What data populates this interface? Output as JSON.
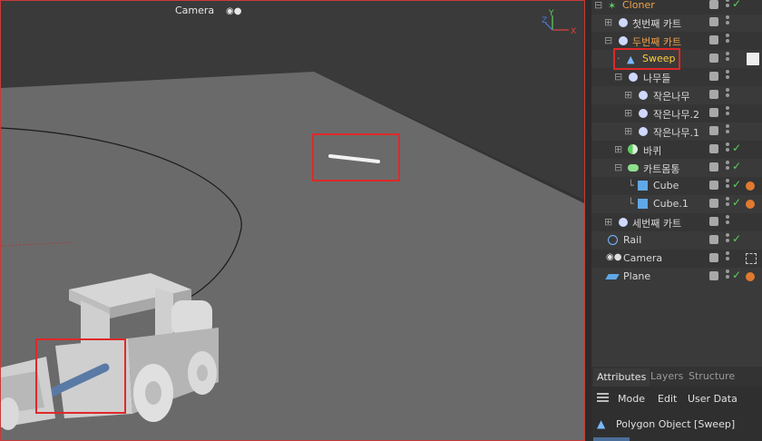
{
  "viewport": {
    "camera_label": "Camera"
  },
  "objects": [
    {
      "name": "Cloner",
      "color": "orange",
      "icon": "cloner-icon"
    },
    {
      "name": "첫번째 카트",
      "color": "normal",
      "icon": "null-icon"
    },
    {
      "name": "두번째 카트",
      "color": "orange",
      "icon": "null-icon"
    },
    {
      "name": "Sweep",
      "color": "yellow",
      "icon": "sweep-icon"
    },
    {
      "name": "나무들",
      "color": "normal",
      "icon": "null-icon"
    },
    {
      "name": "작은나무",
      "color": "normal",
      "icon": "null-icon"
    },
    {
      "name": "작은나무.2",
      "color": "normal",
      "icon": "null-icon"
    },
    {
      "name": "작은나무.1",
      "color": "normal",
      "icon": "null-icon"
    },
    {
      "name": "바퀴",
      "color": "normal",
      "icon": "sphere-icon"
    },
    {
      "name": "카트몸통",
      "color": "normal",
      "icon": "cylinder-icon"
    },
    {
      "name": "Cube",
      "color": "normal",
      "icon": "cube-icon"
    },
    {
      "name": "Cube.1",
      "color": "normal",
      "icon": "cube-icon"
    },
    {
      "name": "세번째 카트",
      "color": "normal",
      "icon": "null-icon"
    },
    {
      "name": "Rail",
      "color": "normal",
      "icon": "circle-spline-icon"
    },
    {
      "name": "Camera",
      "color": "normal",
      "icon": "camera-icon"
    },
    {
      "name": "Plane",
      "color": "normal",
      "icon": "plane-icon"
    }
  ],
  "attributes": {
    "tabs": [
      "Attributes",
      "Layers",
      "Structure"
    ],
    "menu": [
      "Mode",
      "Edit",
      "User Data"
    ],
    "object_title": "Polygon Object [Sweep]"
  },
  "colors": {
    "highlight": "#e02828",
    "accent": "#f0a24a",
    "selected": "#ffcf3a",
    "check": "#5fcf5f"
  }
}
